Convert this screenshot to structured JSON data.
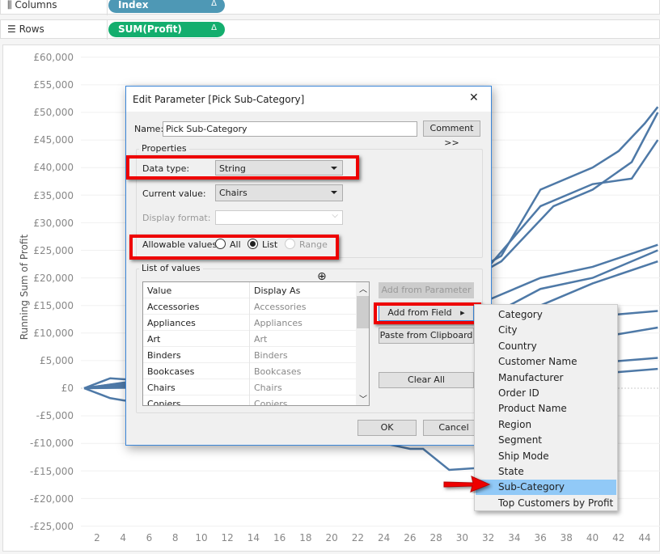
{
  "shelves": {
    "columns_label": "Columns",
    "columns_pill": "Index",
    "rows_label": "Rows",
    "rows_pill": "SUM(Profit)",
    "delta": "Δ",
    "columns_color": "#4e98b5",
    "rows_color": "#14ae6e"
  },
  "chart": {
    "ylabel": "Running Sum of Profit",
    "yticks": [
      "£60,000",
      "£55,000",
      "£50,000",
      "£45,000",
      "£40,000",
      "£35,000",
      "£30,000",
      "£25,000",
      "£20,000",
      "£15,000",
      "£10,000",
      "£5,000",
      "£0",
      "-£5,000",
      "-£10,000",
      "-£15,000",
      "-£20,000",
      "-£25,000"
    ],
    "xticks": [
      "2",
      "4",
      "6",
      "8",
      "10",
      "12",
      "14",
      "16",
      "18",
      "20",
      "22",
      "24",
      "26",
      "28",
      "30",
      "32",
      "34",
      "36",
      "38",
      "40",
      "42",
      "44"
    ],
    "line_color": "#4e79a7"
  },
  "chart_data": {
    "type": "line",
    "xlabel": "",
    "ylabel": "Running Sum of Profit",
    "xlim": [
      1,
      45
    ],
    "ylim": [
      -25000,
      60000
    ],
    "series": [
      {
        "points": [
          [
            1,
            0
          ],
          [
            10,
            3000
          ],
          [
            20,
            8000
          ],
          [
            30,
            20000
          ],
          [
            33,
            24000
          ],
          [
            36,
            36000
          ],
          [
            40,
            40000
          ],
          [
            42,
            43000
          ],
          [
            44,
            48000
          ],
          [
            45,
            51000
          ]
        ]
      },
      {
        "points": [
          [
            1,
            0
          ],
          [
            10,
            2000
          ],
          [
            20,
            7000
          ],
          [
            30,
            19000
          ],
          [
            33,
            23000
          ],
          [
            37,
            33000
          ],
          [
            40,
            36000
          ],
          [
            43,
            41000
          ],
          [
            45,
            50000
          ]
        ]
      },
      {
        "points": [
          [
            1,
            0
          ],
          [
            20,
            6000
          ],
          [
            32,
            22000
          ],
          [
            36,
            33000
          ],
          [
            40,
            37000
          ],
          [
            43,
            38000
          ],
          [
            45,
            45000
          ]
        ]
      },
      {
        "points": [
          [
            1,
            0
          ],
          [
            20,
            5000
          ],
          [
            32,
            16000
          ],
          [
            36,
            20000
          ],
          [
            40,
            22000
          ],
          [
            45,
            26000
          ]
        ]
      },
      {
        "points": [
          [
            1,
            0
          ],
          [
            20,
            4000
          ],
          [
            32,
            13000
          ],
          [
            36,
            18000
          ],
          [
            40,
            20000
          ],
          [
            45,
            25000
          ]
        ]
      },
      {
        "points": [
          [
            1,
            0
          ],
          [
            20,
            3000
          ],
          [
            32,
            11000
          ],
          [
            36,
            15000
          ],
          [
            40,
            19000
          ],
          [
            45,
            23000
          ]
        ]
      },
      {
        "points": [
          [
            1,
            0
          ],
          [
            20,
            2000
          ],
          [
            32,
            9000
          ],
          [
            36,
            13000
          ],
          [
            40,
            13000
          ],
          [
            45,
            14000
          ]
        ]
      },
      {
        "points": [
          [
            1,
            0
          ],
          [
            20,
            1000
          ],
          [
            32,
            5000
          ],
          [
            40,
            9000
          ],
          [
            45,
            11000
          ]
        ]
      },
      {
        "points": [
          [
            1,
            0
          ],
          [
            20,
            500
          ],
          [
            32,
            3000
          ],
          [
            45,
            5500
          ]
        ]
      },
      {
        "points": [
          [
            1,
            0
          ],
          [
            3,
            1800
          ],
          [
            20,
            -1000
          ],
          [
            32,
            1000
          ],
          [
            45,
            3500
          ]
        ]
      },
      {
        "points": [
          [
            1,
            0
          ],
          [
            3,
            -1800
          ],
          [
            4,
            -2200
          ],
          [
            20,
            -7000
          ],
          [
            24,
            -10000
          ],
          [
            26,
            -11000
          ],
          [
            27,
            -11000
          ],
          [
            29,
            -14800
          ],
          [
            31,
            -14500
          ],
          [
            33,
            -14000
          ]
        ]
      }
    ]
  },
  "dialog": {
    "title": "Edit Parameter [Pick Sub-Category]",
    "close": "✕",
    "name_label": "Name:",
    "name_value": "Pick Sub-Category",
    "comment_button": "Comment >>",
    "properties_legend": "Properties",
    "data_type_label": "Data type:",
    "data_type_value": "String",
    "current_value_label": "Current value:",
    "current_value": "Chairs",
    "display_format_label": "Display format:",
    "display_format_value": "",
    "allowable_label": "Allowable values:",
    "allowable_options": [
      "All",
      "List",
      "Range"
    ],
    "allowable_selected": "List",
    "list_legend": "List of values",
    "list_headers": [
      "Value",
      "Display As"
    ],
    "list_rows": [
      [
        "Accessories",
        "Accessories"
      ],
      [
        "Appliances",
        "Appliances"
      ],
      [
        "Art",
        "Art"
      ],
      [
        "Binders",
        "Binders"
      ],
      [
        "Bookcases",
        "Bookcases"
      ],
      [
        "Chairs",
        "Chairs"
      ],
      [
        "Copiers",
        "Copiers"
      ]
    ],
    "add_from_parameter": "Add from Parameter",
    "add_from_field": "Add from Field",
    "paste_clipboard": "Paste from Clipboard",
    "clear_all": "Clear All",
    "ok": "OK",
    "cancel": "Cancel"
  },
  "menu": {
    "items": [
      "Category",
      "City",
      "Country",
      "Customer Name",
      "Manufacturer",
      "Order ID",
      "Product Name",
      "Region",
      "Segment",
      "Ship Mode",
      "State",
      "Sub-Category",
      "Top Customers by Profit"
    ],
    "highlighted": "Sub-Category"
  }
}
